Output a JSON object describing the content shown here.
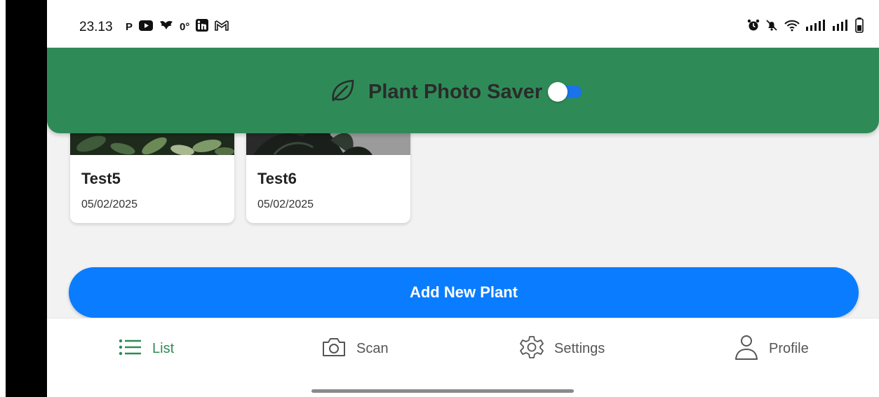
{
  "status_bar": {
    "time": "23.13",
    "left_icons": [
      "P",
      "youtube-icon",
      "bird-icon",
      "0°",
      "linkedin-icon",
      "gmail-icon"
    ],
    "right_icons": [
      "alarm-icon",
      "bell-muted-icon",
      "wifi-icon",
      "signal-icon",
      "signal-icon",
      "battery-icon"
    ]
  },
  "app_bar": {
    "title": "Plant Photo Saver",
    "icon": "leaf-icon",
    "background_color": "#2e8b57",
    "toggle_on": true,
    "toggle_color": "#1a73e8"
  },
  "plants": [
    {
      "name": "Test5",
      "date": "05/02/2025"
    },
    {
      "name": "Test6",
      "date": "05/02/2025"
    }
  ],
  "add_button": {
    "label": "Add New Plant",
    "color": "#0a7cff"
  },
  "bottom_nav": {
    "active": "List",
    "active_color": "#2e8b57",
    "items": [
      {
        "label": "List",
        "icon": "list-icon"
      },
      {
        "label": "Scan",
        "icon": "camera-icon"
      },
      {
        "label": "Settings",
        "icon": "gear-icon"
      },
      {
        "label": "Profile",
        "icon": "person-icon"
      }
    ]
  }
}
